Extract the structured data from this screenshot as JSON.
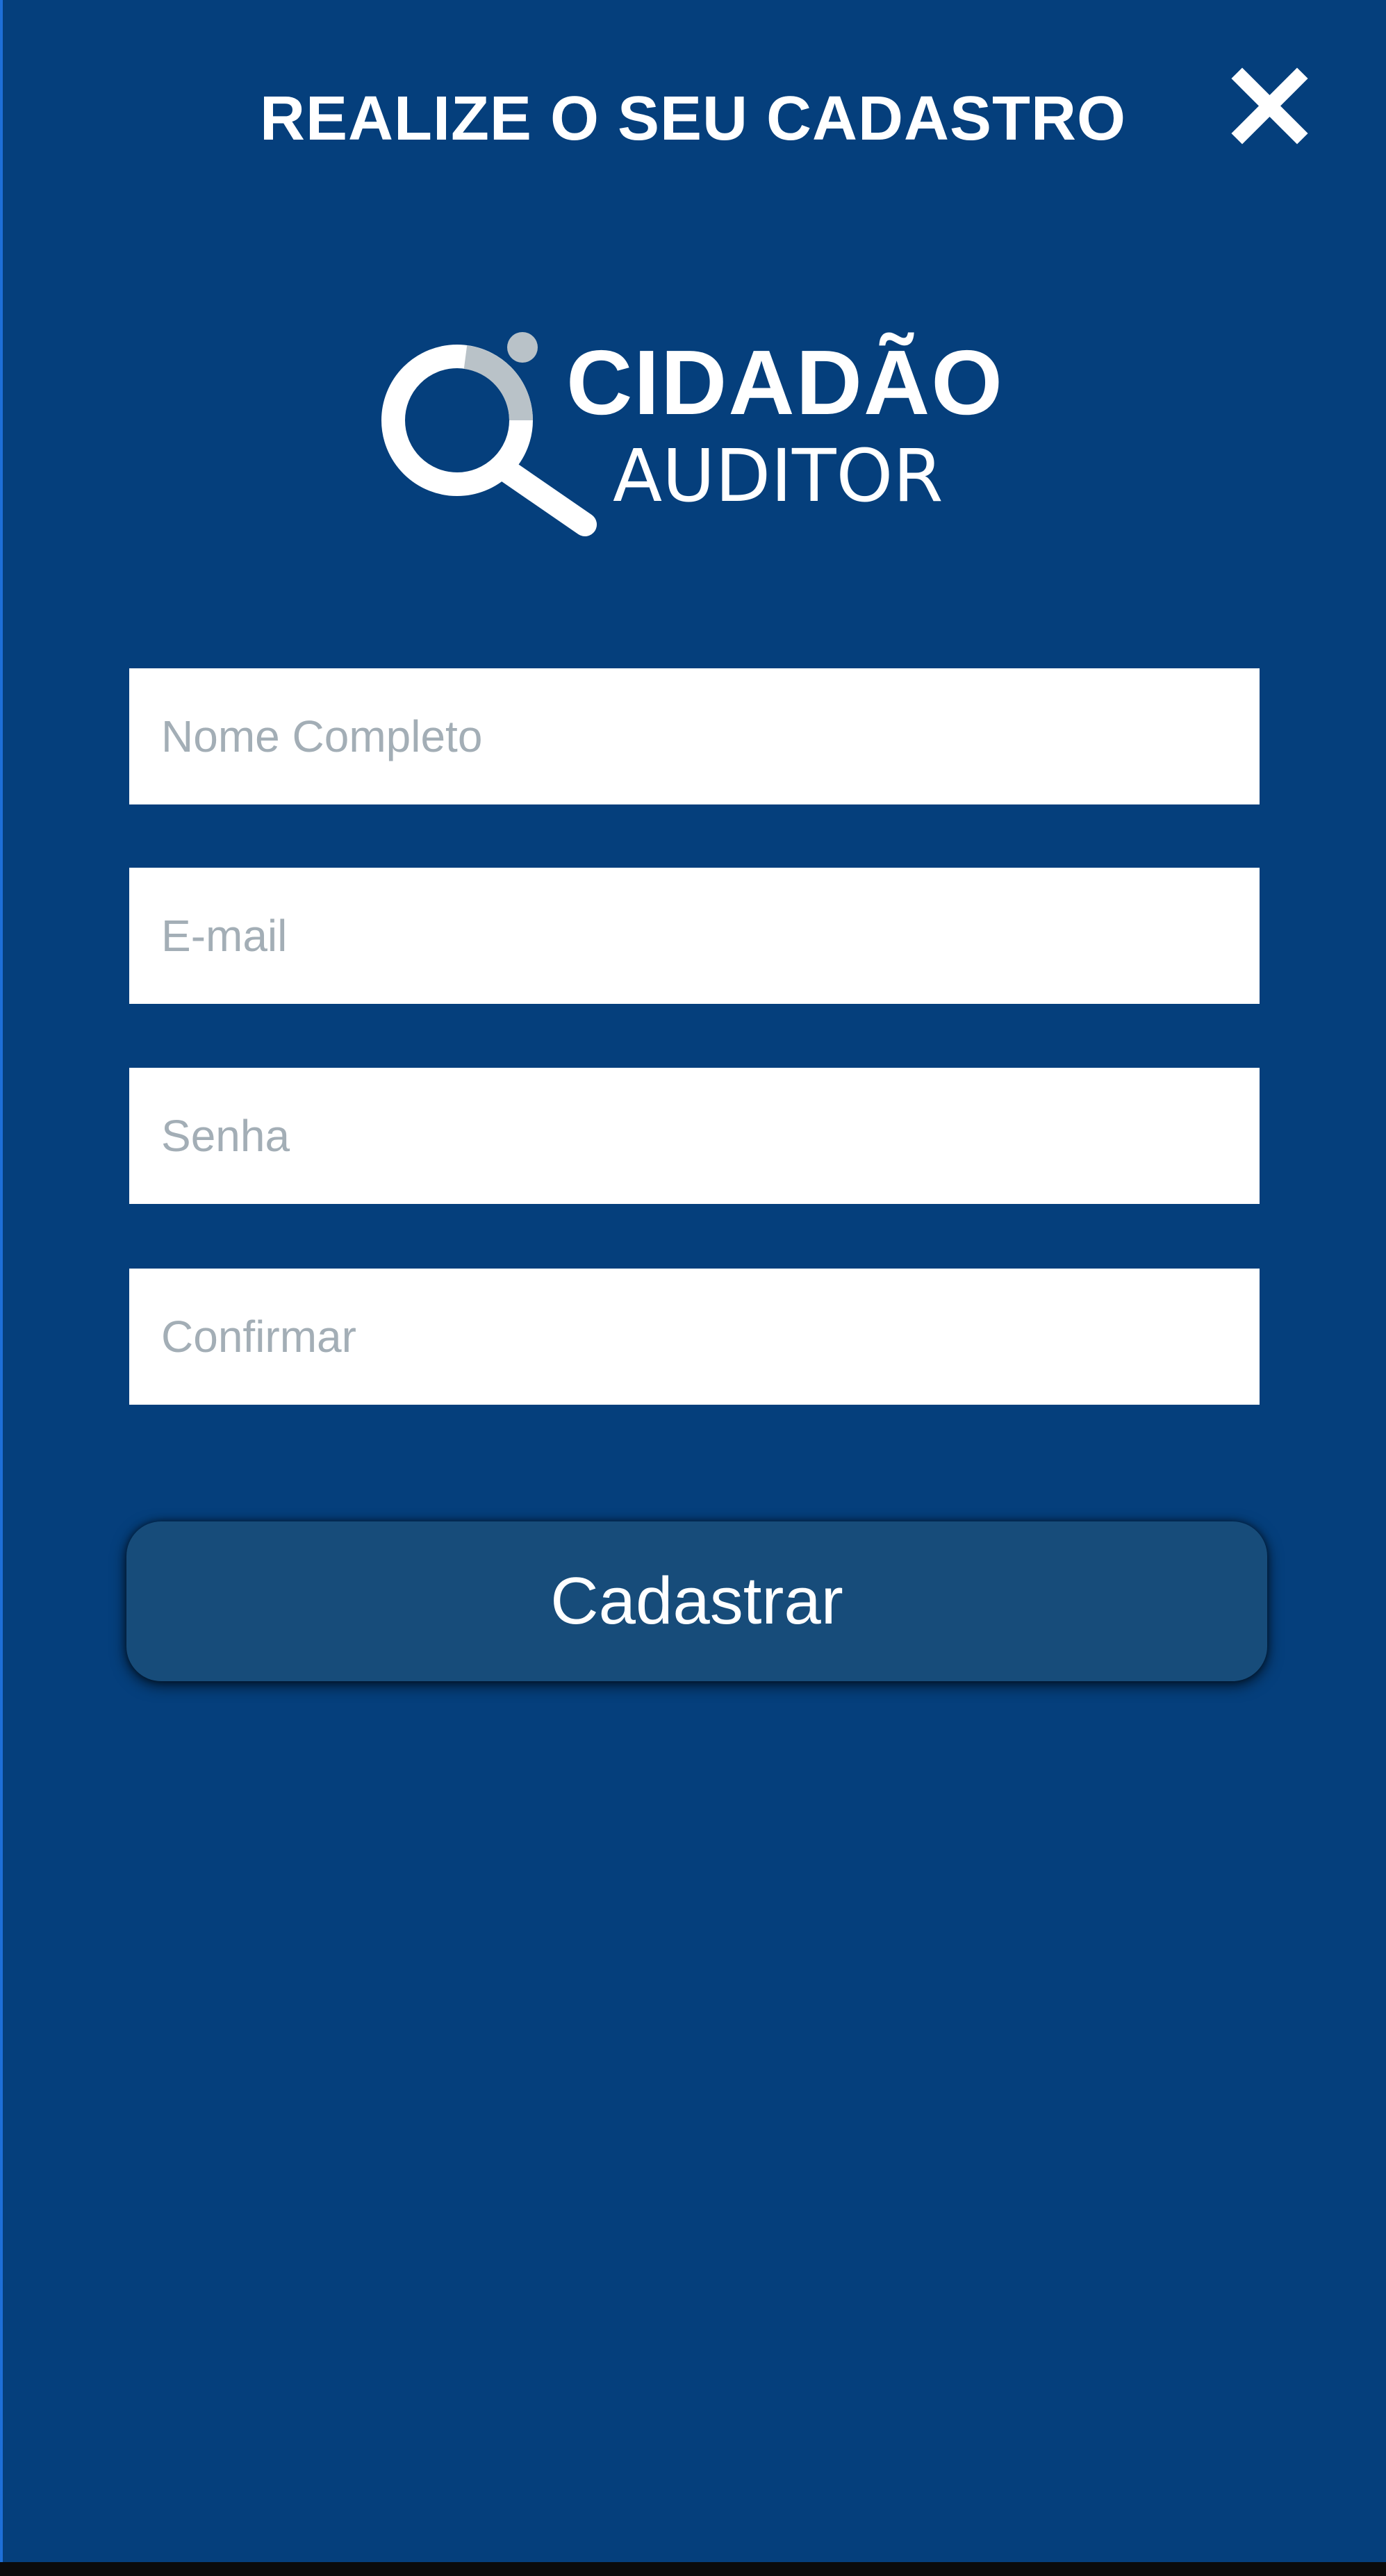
{
  "header": {
    "title": "REALIZE O SEU CADASTRO",
    "close_icon": "close-icon"
  },
  "logo": {
    "line1": "CIDADÃO",
    "line2": "AUDITOR",
    "icon": "magnifier-icon"
  },
  "form": {
    "name_placeholder": "Nome Completo",
    "email_placeholder": "E-mail",
    "password_placeholder": "Senha",
    "confirm_placeholder": "Confirmar",
    "submit_label": "Cadastrar"
  },
  "colors": {
    "background": "#053f7c",
    "button": "#174c7a",
    "field": "#ffffff",
    "placeholder": "#a3aeb6"
  }
}
